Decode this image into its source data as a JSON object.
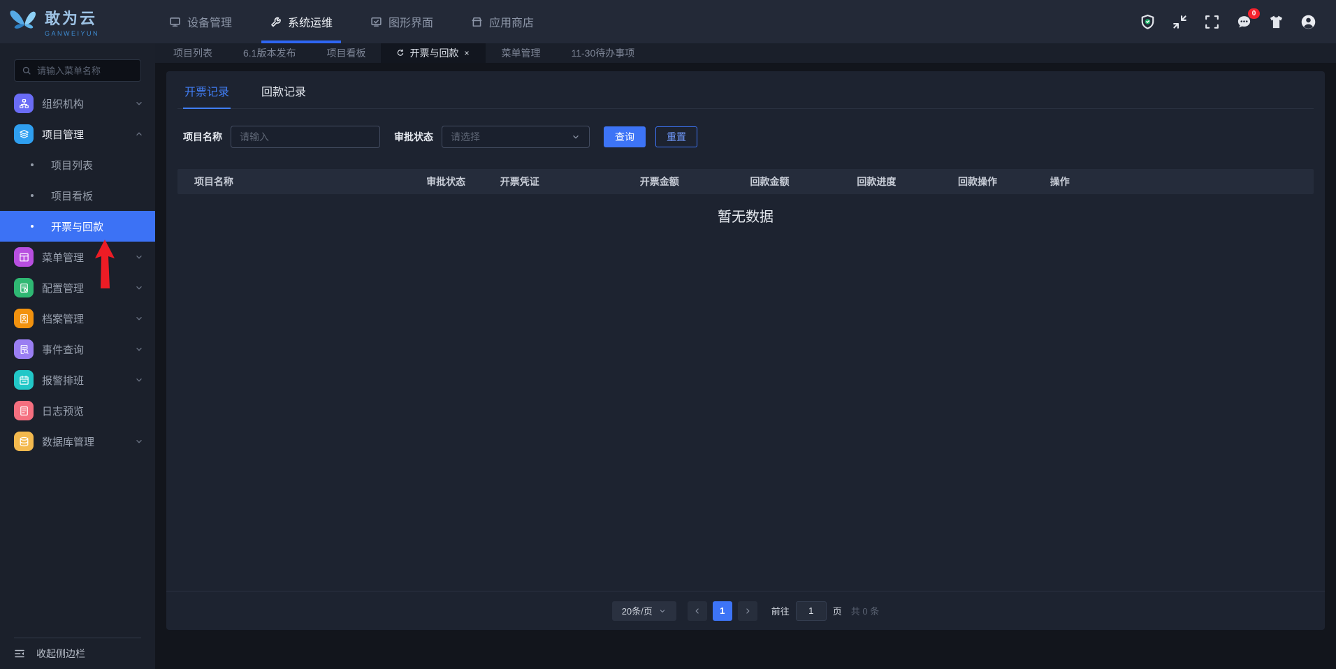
{
  "topbar": {
    "brand": {
      "title": "敢为云",
      "subtitle": "GANWEIYUN"
    },
    "nav": [
      {
        "label": "设备管理",
        "icon": "device-monitor-icon",
        "active": false
      },
      {
        "label": "系统运维",
        "icon": "wrench-icon",
        "active": true
      },
      {
        "label": "图形界面",
        "icon": "graphic-screen-icon",
        "active": false
      },
      {
        "label": "应用商店",
        "icon": "app-store-icon",
        "active": false
      }
    ],
    "right": {
      "badge_count": "0"
    }
  },
  "tabstrip": {
    "tabs": [
      {
        "label": "项目列表",
        "active": false
      },
      {
        "label": "6.1版本发布",
        "active": false
      },
      {
        "label": "项目看板",
        "active": false
      },
      {
        "label": "开票与回款",
        "active": true,
        "refreshable": true,
        "closable": true
      },
      {
        "label": "菜单管理",
        "active": false
      },
      {
        "label": "11-30待办事项",
        "active": false
      }
    ]
  },
  "sidebar": {
    "search": {
      "placeholder": "请输入菜单名称"
    },
    "items": [
      {
        "label": "组织机构",
        "icon": "org-chart-icon",
        "color": "#6a6cf5",
        "chevron": "down"
      },
      {
        "label": "项目管理",
        "icon": "layers-icon",
        "color": "#2f9ff0",
        "chevron": "up",
        "active_parent": true,
        "children": [
          {
            "label": "项目列表",
            "active": false
          },
          {
            "label": "项目看板",
            "active": false
          },
          {
            "label": "开票与回款",
            "active": true
          }
        ]
      },
      {
        "label": "菜单管理",
        "icon": "menu-grid-icon",
        "color": "#b84fe0",
        "chevron": "down"
      },
      {
        "label": "配置管理",
        "icon": "config-doc-icon",
        "color": "#2fb873",
        "chevron": "down"
      },
      {
        "label": "档案管理",
        "icon": "archive-doc-icon",
        "color": "#f2920f",
        "chevron": "down"
      },
      {
        "label": "事件查询",
        "icon": "event-search-icon",
        "color": "#9a7ef2",
        "chevron": "down"
      },
      {
        "label": "报警排班",
        "icon": "calendar-icon",
        "color": "#22c7c7",
        "chevron": "down"
      },
      {
        "label": "日志预览",
        "icon": "log-doc-icon",
        "color": "#f56f7f",
        "chevron": null
      },
      {
        "label": "数据库管理",
        "icon": "database-icon",
        "color": "#f3b94e",
        "chevron": "down"
      }
    ],
    "collapse_label": "收起侧边栏"
  },
  "main": {
    "tabs": [
      {
        "label": "开票记录",
        "active": true
      },
      {
        "label": "回款记录",
        "active": false
      }
    ],
    "filters": {
      "name_label": "项目名称",
      "name_placeholder": "请输入",
      "status_label": "审批状态",
      "status_placeholder": "请选择",
      "search_button": "查询",
      "reset_button": "重置"
    },
    "table": {
      "columns": [
        "项目名称",
        "审批状态",
        "开票凭证",
        "开票金额",
        "回款金额",
        "回款进度",
        "回款操作",
        "操作"
      ],
      "rows": [],
      "empty_text": "暂无数据"
    },
    "pagination": {
      "page_size": "20条/页",
      "current_page": "1",
      "goto_label": "前往",
      "goto_value": "1",
      "page_unit_label": "页",
      "total_label": "共 0 条"
    }
  },
  "annotation": {
    "arrow_color": "#ee1c25"
  },
  "colors": {
    "accent": "#3d74f6",
    "badge": "#f5222d"
  }
}
